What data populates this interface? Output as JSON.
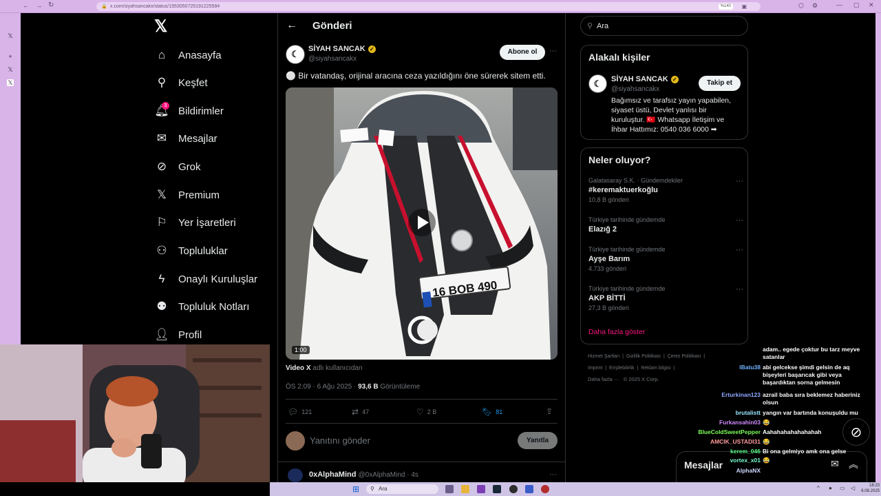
{
  "browser": {
    "url": "x.com/siyahsancakx/status/1953050725191225584",
    "zoom_badge": "%140"
  },
  "nav": {
    "items": [
      {
        "label": "Anasayfa",
        "icon": "home-icon"
      },
      {
        "label": "Keşfet",
        "icon": "search-icon"
      },
      {
        "label": "Bildirimler",
        "icon": "bell-icon"
      },
      {
        "label": "Mesajlar",
        "icon": "mail-icon"
      },
      {
        "label": "Grok",
        "icon": "grok-icon"
      },
      {
        "label": "Premium",
        "icon": "x-premium-icon"
      },
      {
        "label": "Yer İşaretleri",
        "icon": "bookmark-icon"
      },
      {
        "label": "Topluluklar",
        "icon": "communities-icon"
      },
      {
        "label": "Onaylı Kuruluşlar",
        "icon": "lightning-icon"
      },
      {
        "label": "Topluluk Notları",
        "icon": "community-notes-icon"
      },
      {
        "label": "Profil",
        "icon": "person-icon"
      }
    ],
    "notification_count": "3"
  },
  "post": {
    "header_title": "Gönderi",
    "author_name": "SİYAH SANCAK",
    "author_handle": "@siyahsancakx",
    "subscribe_label": "Abone ol",
    "text": "⚪ Bir vatandaş, orijinal aracına ceza yazıldığını öne sürerek sitem etti.",
    "video_duration": "1:00",
    "plate": "16 BOB 490",
    "video_source_bold": "Video X",
    "video_source_rest": "adlı kullanıcıdan",
    "timestamp": "ÖS 2:09 · 6 Ağu 2025 · ",
    "views_bold": "93,6 B",
    "views_label": "Görüntüleme",
    "replies": "121",
    "reposts": "47",
    "likes": "2 B",
    "bookmarks": "81",
    "reply_placeholder": "Yanıtını gönder",
    "reply_button": "Yanıtla",
    "next_reply_name": "0xAlphaMind",
    "next_reply_meta": "@0xAlphaMind · 4s"
  },
  "sidebar": {
    "search_value": "Ara",
    "related_title": "Alakalı kişiler",
    "related_name": "SİYAH SANCAK",
    "related_handle": "@siyahsancakx",
    "follow_label": "Takip et",
    "related_bio": "Bağımsız ve tarafsız yayın yapabilen, siyaset üstü, Devlet yanlısı bir kuruluştur. 🇹🇷 Whatsapp İletişim ve İhbar Hattımız: 0540 036 6000 ➡",
    "trends_title": "Neler oluyor?",
    "trends": [
      {
        "category": "Galatasaray S.K. · Gündemdekiler",
        "name": "#keremaktuerkoğlu",
        "count": "10,8 B gönderi"
      },
      {
        "category": "Türkiye tarihinde gündemde",
        "name": "Elazığ 2",
        "count": ""
      },
      {
        "category": "Türkiye tarihinde gündemde",
        "name": "Ayşe Barım",
        "count": "4.733 gönderi"
      },
      {
        "category": "Türkiye tarihinde gündemde",
        "name": "AKP BİTTİ",
        "count": "27,3 B gönderi"
      }
    ],
    "show_more": "Daha fazla göster",
    "footer_line1": [
      "Hizmet Şartları",
      "Gizlilik Politikası",
      "Çerez Politikası"
    ],
    "footer_line2": [
      "Imprint",
      "Erişilebilirlik",
      "Reklam bilgisi"
    ],
    "footer_more": "Daha fazla ···",
    "footer_copyright": "© 2025 X Corp."
  },
  "messages_drawer": {
    "label": "Mesajlar"
  },
  "chat": {
    "lines": [
      {
        "user": "",
        "user_color": "#ffffff",
        "msg": "adam.. egede çoktur bu tarz meyve satanlar"
      },
      {
        "user": "lBatu38",
        "user_color": "#6fb3ff",
        "msg": "abi gelcekse şimdi gelsin de aq bişeyleri başarıcak gibi veya başardıktan sorna gelmesin"
      },
      {
        "user": "Erturkinan123",
        "user_color": "#8fa8ff",
        "msg": "azrail baba sıra beklemez haberiniz olsun"
      },
      {
        "user": "brutalistt",
        "user_color": "#9be7ff",
        "msg": "yangın var bartında konuşuldu mu"
      },
      {
        "user": "Furkansahin03",
        "user_color": "#d28bff",
        "msg": "😂"
      },
      {
        "user": "BlueColdSweetPepper",
        "user_color": "#7cff5a",
        "msg": "Aahahahahahahahah"
      },
      {
        "user": "AMCIK_USTADI31",
        "user_color": "#ff9a9a",
        "msg": "😂"
      },
      {
        "user": "kerem_046",
        "user_color": "#5aff8a",
        "msg": "Bi ona gelmiyo amk ona gelse"
      },
      {
        "user": "vortex_x01",
        "user_color": "#7affd1",
        "msg": "😂"
      },
      {
        "user": "AlphaNX",
        "user_color": "#cfd8ff",
        "msg": ""
      }
    ]
  },
  "taskbar": {
    "search_placeholder": "Ara",
    "time": "18:23",
    "date": "6.08.2025"
  },
  "colors": {
    "accent_blue": "#1d9bf0",
    "trend_link": "#f91880",
    "verified_gold": "#e2b719"
  }
}
